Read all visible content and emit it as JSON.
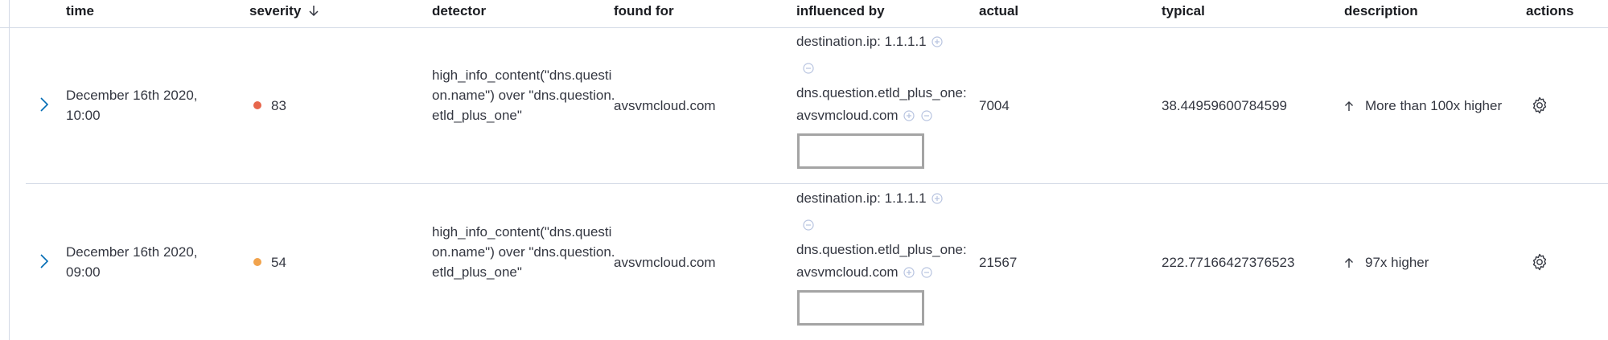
{
  "columns": {
    "time": "time",
    "severity": "severity",
    "detector": "detector",
    "found_for": "found for",
    "influenced_by": "influenced by",
    "actual": "actual",
    "typical": "typical",
    "description": "description",
    "actions": "actions"
  },
  "colors": {
    "critical": "#e7664c",
    "major": "#f1a34d",
    "icon_light": "#b8c4e0",
    "link": "#006bb4"
  },
  "rows": [
    {
      "time": "December 16th 2020, 10:00",
      "severity_score": "83",
      "severity_level": "critical",
      "detector": "high_info_content(\"dns.question.name\") over \"dns.question.etld_plus_one\"",
      "found_for": "avsvmcloud.com",
      "influencers": [
        {
          "label": "destination.ip: 1.1.1.1"
        },
        {
          "field": "dns.question.etld_plus_one:",
          "value": "avsvmcloud.com"
        }
      ],
      "actual": "7004",
      "typical": "38.44959600784599",
      "description": "More than 100x higher"
    },
    {
      "time": "December 16th 2020, 09:00",
      "severity_score": "54",
      "severity_level": "major",
      "detector": "high_info_content(\"dns.question.name\") over \"dns.question.etld_plus_one\"",
      "found_for": "avsvmcloud.com",
      "influencers": [
        {
          "label": "destination.ip: 1.1.1.1"
        },
        {
          "field": "dns.question.etld_plus_one:",
          "value": "avsvmcloud.com"
        }
      ],
      "actual": "21567",
      "typical": "222.77166427376523",
      "description": "97x higher"
    }
  ]
}
